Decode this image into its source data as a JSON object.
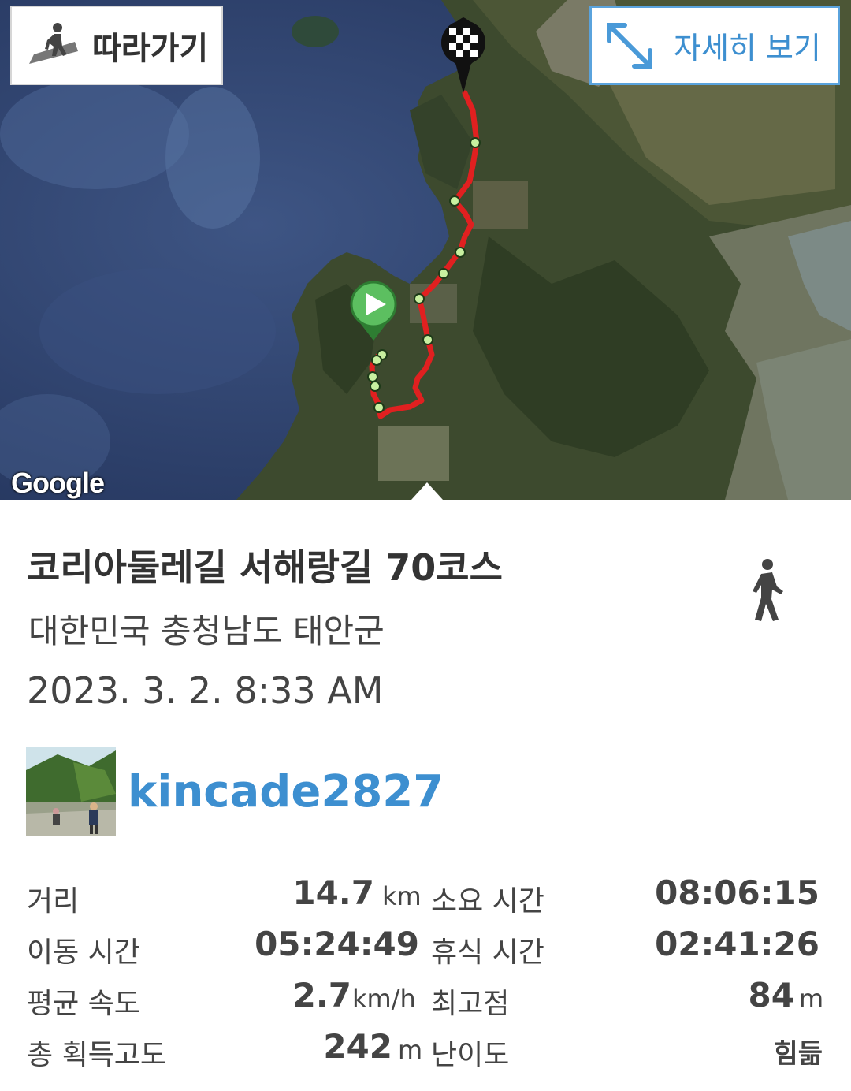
{
  "map": {
    "follow_label": "따라가기",
    "detail_label": "자세히 보기",
    "attribution": "Google",
    "route_color": "#e02020",
    "start_marker": "play-icon",
    "end_marker": "checkered-flag-icon"
  },
  "route": {
    "title": "코리아둘레길 서해랑길 70코스",
    "region": "대한민국 충청남도 태안군",
    "datetime": "2023. 3. 2. 8:33 AM",
    "activity_icon": "walking-icon"
  },
  "user": {
    "name": "kincade2827"
  },
  "stats": {
    "distance": {
      "label": "거리",
      "value": "14.7",
      "unit": "km"
    },
    "duration": {
      "label": "소요 시간",
      "value": "08:06:15"
    },
    "moving_time": {
      "label": "이동 시간",
      "value": "05:24:49"
    },
    "rest_time": {
      "label": "휴식 시간",
      "value": "02:41:26"
    },
    "avg_speed": {
      "label": "평균 속도",
      "value": "2.7",
      "unit": "km/h"
    },
    "max_elevation": {
      "label": "최고점",
      "value": "84",
      "unit": "m"
    },
    "elevation_gain": {
      "label": "총 획득고도",
      "value": "242",
      "unit": "m"
    },
    "difficulty": {
      "label": "난이도",
      "value": "힘듦"
    }
  },
  "colors": {
    "accent": "#3d8fd0",
    "start_marker": "#4caf50"
  }
}
